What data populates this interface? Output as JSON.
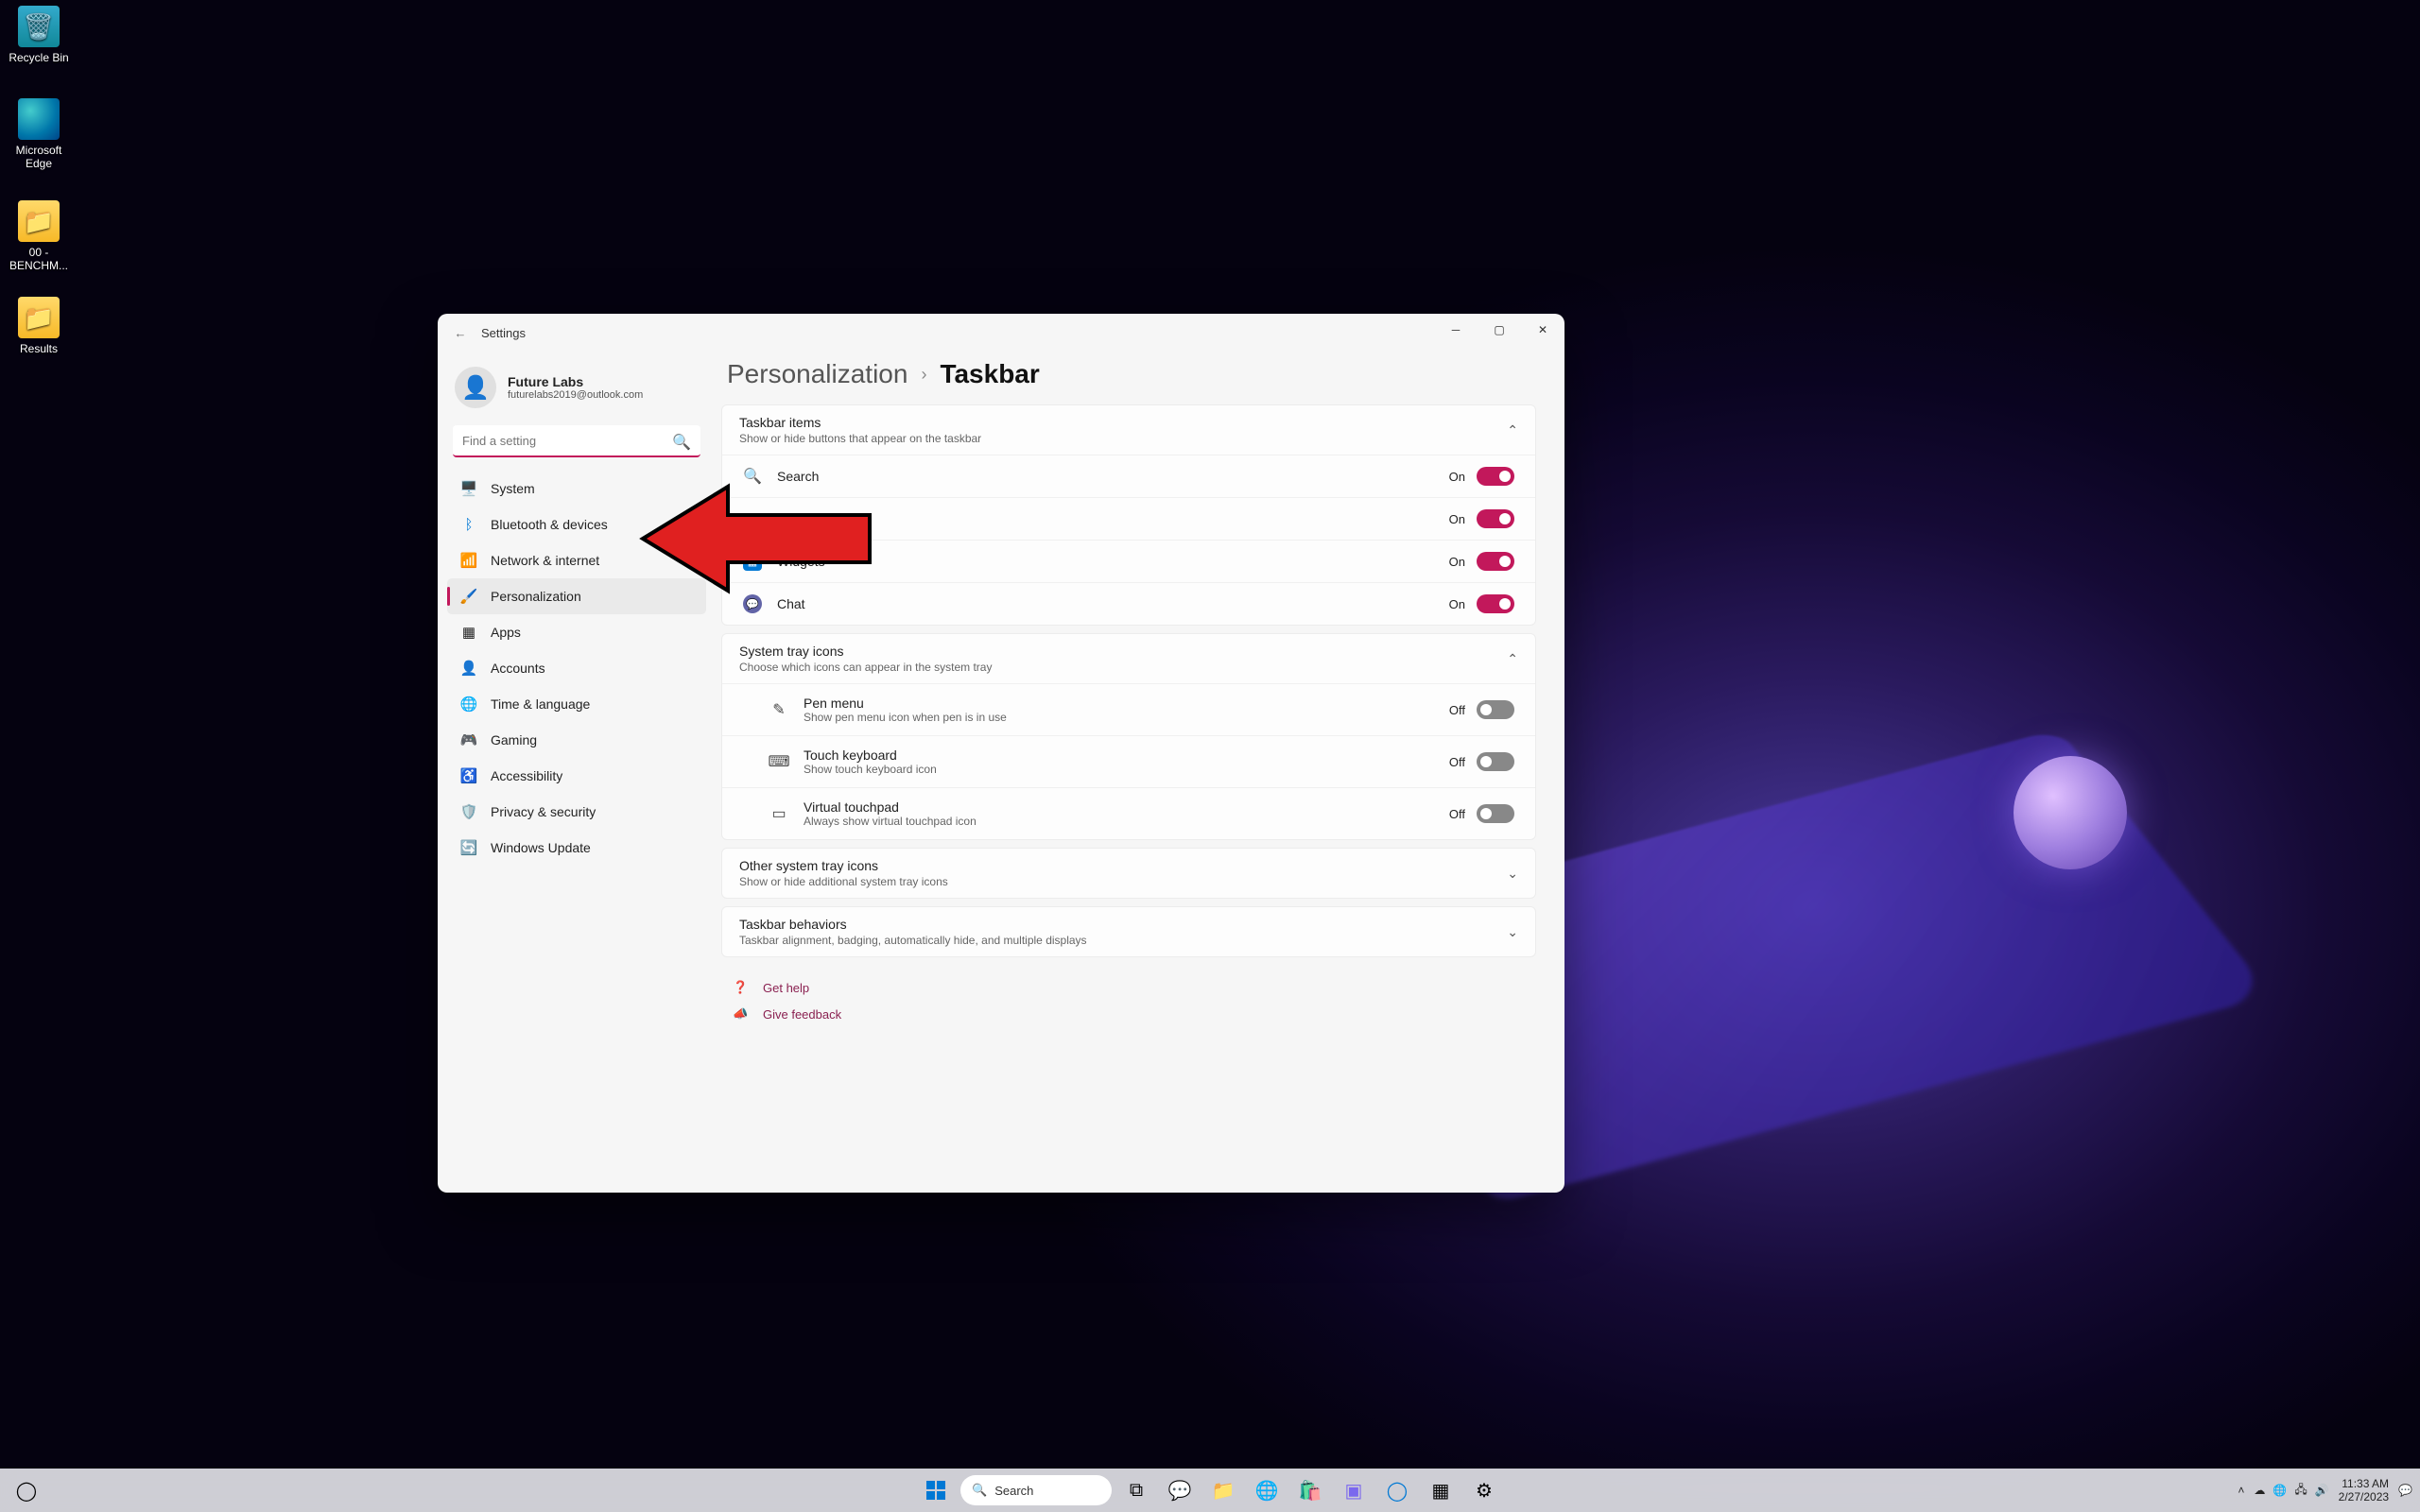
{
  "desktop_icons": [
    {
      "label": "Recycle Bin"
    },
    {
      "label": "Microsoft Edge"
    },
    {
      "label": "00 - BENCHM..."
    },
    {
      "label": "Results"
    }
  ],
  "window": {
    "title": "Settings",
    "user": {
      "name": "Future Labs",
      "email": "futurelabs2019@outlook.com"
    },
    "search": {
      "placeholder": "Find a setting"
    },
    "nav": [
      {
        "label": "System"
      },
      {
        "label": "Bluetooth & devices"
      },
      {
        "label": "Network & internet"
      },
      {
        "label": "Personalization"
      },
      {
        "label": "Apps"
      },
      {
        "label": "Accounts"
      },
      {
        "label": "Time & language"
      },
      {
        "label": "Gaming"
      },
      {
        "label": "Accessibility"
      },
      {
        "label": "Privacy & security"
      },
      {
        "label": "Windows Update"
      }
    ],
    "breadcrumb": {
      "parent": "Personalization",
      "current": "Taskbar"
    },
    "taskbar_items": {
      "title": "Taskbar items",
      "sub": "Show or hide buttons that appear on the taskbar",
      "rows": [
        {
          "label": "Search",
          "state": "On",
          "on": true
        },
        {
          "label": "",
          "state": "On",
          "on": true
        },
        {
          "label": "Widgets",
          "state": "On",
          "on": true
        },
        {
          "label": "Chat",
          "state": "On",
          "on": true
        }
      ]
    },
    "tray": {
      "title": "System tray icons",
      "sub": "Choose which icons can appear in the system tray",
      "rows": [
        {
          "label": "Pen menu",
          "sub": "Show pen menu icon when pen is in use",
          "state": "Off",
          "on": false
        },
        {
          "label": "Touch keyboard",
          "sub": "Show touch keyboard icon",
          "state": "Off",
          "on": false
        },
        {
          "label": "Virtual touchpad",
          "sub": "Always show virtual touchpad icon",
          "state": "Off",
          "on": false
        }
      ]
    },
    "other_tray": {
      "title": "Other system tray icons",
      "sub": "Show or hide additional system tray icons"
    },
    "behaviors": {
      "title": "Taskbar behaviors",
      "sub": "Taskbar alignment, badging, automatically hide, and multiple displays"
    },
    "links": {
      "help": "Get help",
      "feedback": "Give feedback"
    }
  },
  "taskbar": {
    "search": "Search",
    "time": "11:33 AM",
    "date": "2/27/2023"
  }
}
